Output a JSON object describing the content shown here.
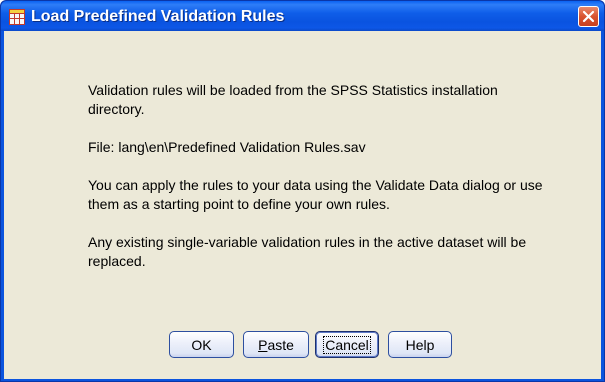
{
  "window": {
    "title": "Load Predefined Validation Rules",
    "icon": "spss-dialog-grid-icon",
    "close_icon": "close-icon",
    "accent_color": "#0b54de",
    "close_color": "#d9532f"
  },
  "message": {
    "para1": "Validation rules will be loaded from the SPSS Statistics installation directory.",
    "para2": "File:  lang\\en\\Predefined Validation Rules.sav",
    "para3": "You can apply the rules to your data using the Validate Data dialog or use them as a starting point to define your own rules.",
    "para4": "Any existing single-variable validation rules in the active dataset will be replaced."
  },
  "buttons": {
    "ok": "OK",
    "paste_mnemonic": "P",
    "paste_rest": "aste",
    "cancel": "Cancel",
    "help": "Help"
  }
}
